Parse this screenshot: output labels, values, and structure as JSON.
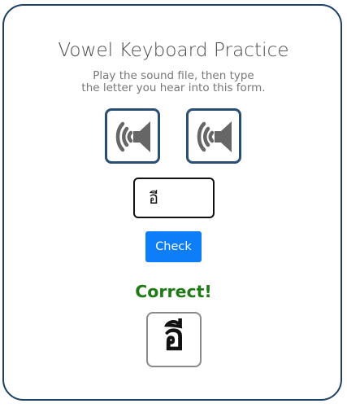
{
  "page": {
    "title": "Vowel Keyboard Practice",
    "instructions_line1": "Play the sound file, then type",
    "instructions_line2": "the letter you hear into this form."
  },
  "sound_buttons": [
    {
      "icon": "speaker-icon"
    },
    {
      "icon": "speaker-icon"
    }
  ],
  "answer_input": {
    "value": "อี",
    "placeholder": ""
  },
  "check_button": {
    "label": "Check"
  },
  "result": {
    "message": "Correct!",
    "color": "#1f7a16"
  },
  "answer_card": {
    "letter": "อี"
  },
  "colors": {
    "card_border": "#1c3f66",
    "button_primary": "#0d7ef7",
    "sound_border": "#2a4f74"
  }
}
